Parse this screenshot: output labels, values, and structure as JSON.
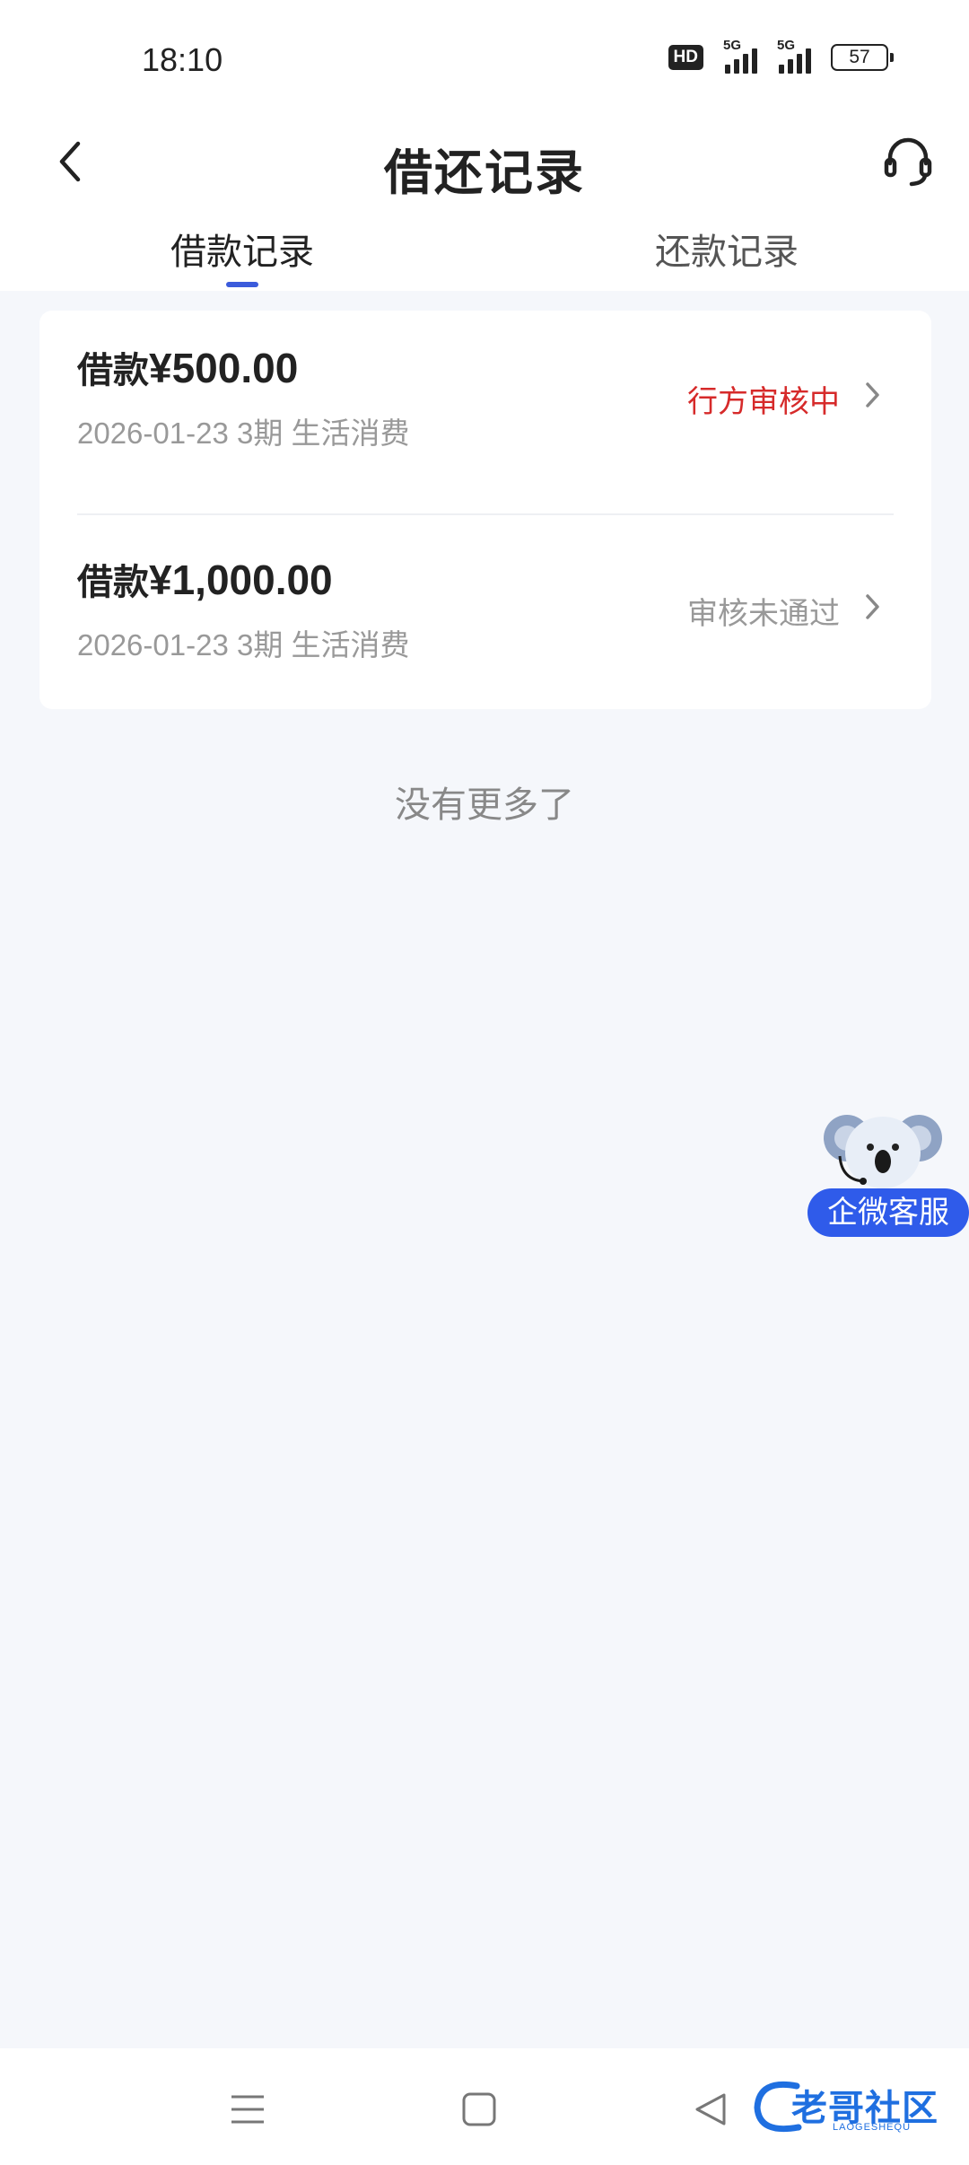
{
  "status_bar": {
    "time": "18:10",
    "hd_badge": "HD",
    "signal_1_label": "5G",
    "signal_2_label": "5G",
    "battery": "57"
  },
  "header": {
    "title": "借还记录",
    "back_icon": "chevron-left-icon",
    "service_icon": "headset-icon"
  },
  "tabs": [
    {
      "label": "借款记录",
      "active": true
    },
    {
      "label": "还款记录",
      "active": false
    }
  ],
  "records": [
    {
      "title_prefix": "借款",
      "amount": "¥500.00",
      "meta": "2026-01-23 3期  生活消费",
      "status": "行方审核中",
      "status_color": "#d62a2a"
    },
    {
      "title_prefix": "借款",
      "amount": "¥1,000.00",
      "meta": "2026-01-23 3期  生活消费",
      "status": "审核未通过",
      "status_color": "#999999"
    }
  ],
  "footer_text": "没有更多了",
  "float_service": {
    "label": "企微客服",
    "icon": "koala-mascot-icon"
  },
  "bottom_nav": {
    "menu_icon": "menu-icon",
    "home_icon": "home-square-icon",
    "back_icon": "back-triangle-icon"
  },
  "watermark": {
    "text": "老哥社区",
    "subtext": "LAOGESHEQU"
  },
  "colors": {
    "accent": "#3b5bdb",
    "float_button": "#2f5bea",
    "background": "#f5f7fb"
  }
}
